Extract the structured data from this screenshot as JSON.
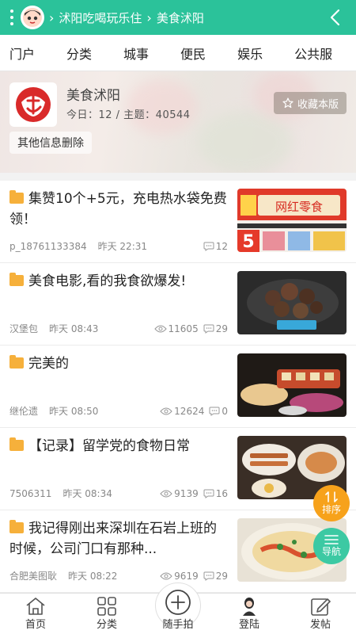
{
  "header": {
    "breadcrumb": [
      "沭阳吃喝玩乐住",
      "美食沭阳"
    ],
    "color": "#2bc29a"
  },
  "tabs": [
    "门户",
    "分类",
    "城事",
    "便民",
    "娱乐",
    "公共服"
  ],
  "forum": {
    "name": "美食沭阳",
    "stats_label": "今日：12 / 主题：40544",
    "favorite_label": "收藏本版",
    "notice_label": "其他信息删除"
  },
  "posts": [
    {
      "title": "集赞10个+5元，充电热水袋免费领！",
      "author": "p_18761133384",
      "time": "昨天 22:31",
      "views": "",
      "comments": "12"
    },
    {
      "title": "美食电影,看的我食欲爆发!",
      "author": "汉堡包",
      "time": "昨天 08:43",
      "views": "11605",
      "comments": "29"
    },
    {
      "title": "完美的",
      "author": "继伦遗",
      "time": "昨天 08:50",
      "views": "12624",
      "comments": "0"
    },
    {
      "title": "【记录】留学党的食物日常",
      "author": "7506311",
      "time": "昨天 08:34",
      "views": "9139",
      "comments": "16"
    },
    {
      "title": "我记得刚出来深圳在石岩上班的时候，公司门口有那种...",
      "author": "合肥美图耿",
      "time": "昨天 08:22",
      "views": "9619",
      "comments": "29"
    }
  ],
  "thumb_texts": {
    "t0": "网红零食",
    "t0_num": "5"
  },
  "fab": {
    "sort_label": "排序",
    "nav_label": "导航"
  },
  "bottom_nav": [
    "首页",
    "分类",
    "随手拍",
    "登陆",
    "发帖"
  ]
}
